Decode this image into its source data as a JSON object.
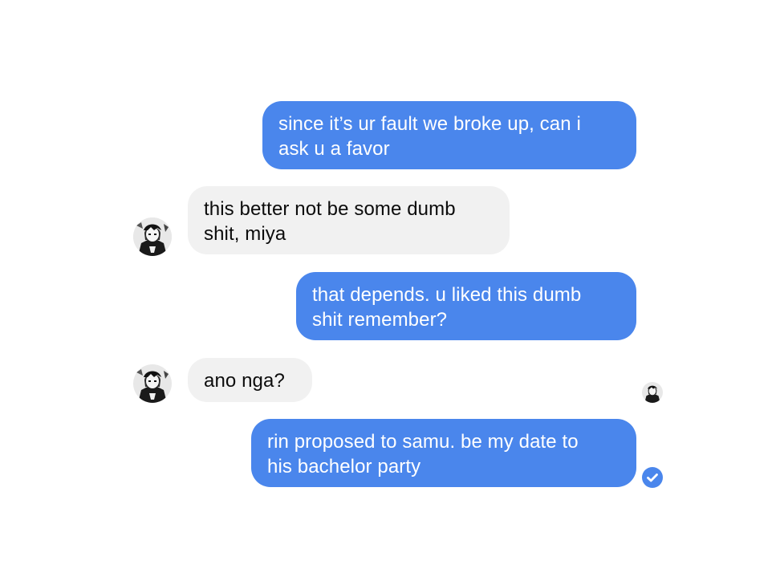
{
  "thread": {
    "messages": [
      {
        "sender": "me",
        "text": "since it’s ur fault we broke up, can i\nask u a favor"
      },
      {
        "sender": "contact",
        "text": "this better not be some dumb\nshit, miya"
      },
      {
        "sender": "me",
        "text": "that depends. u liked this dumb\nshit remember?"
      },
      {
        "sender": "contact",
        "text": "ano nga?"
      },
      {
        "sender": "me",
        "text": "rin proposed to samu. be my date to\nhis bachelor party"
      }
    ]
  },
  "icons": {
    "contact_avatar": "avatar-photo-icon",
    "read_receipt": "read-receipt-avatar-icon",
    "delivered": "delivered-check-icon"
  },
  "colors": {
    "outgoing_bubble": "#4a86ec",
    "incoming_bubble": "#f1f1f1",
    "outgoing_text": "#ffffff",
    "incoming_text": "#0c0c0c",
    "background": "#ffffff"
  }
}
